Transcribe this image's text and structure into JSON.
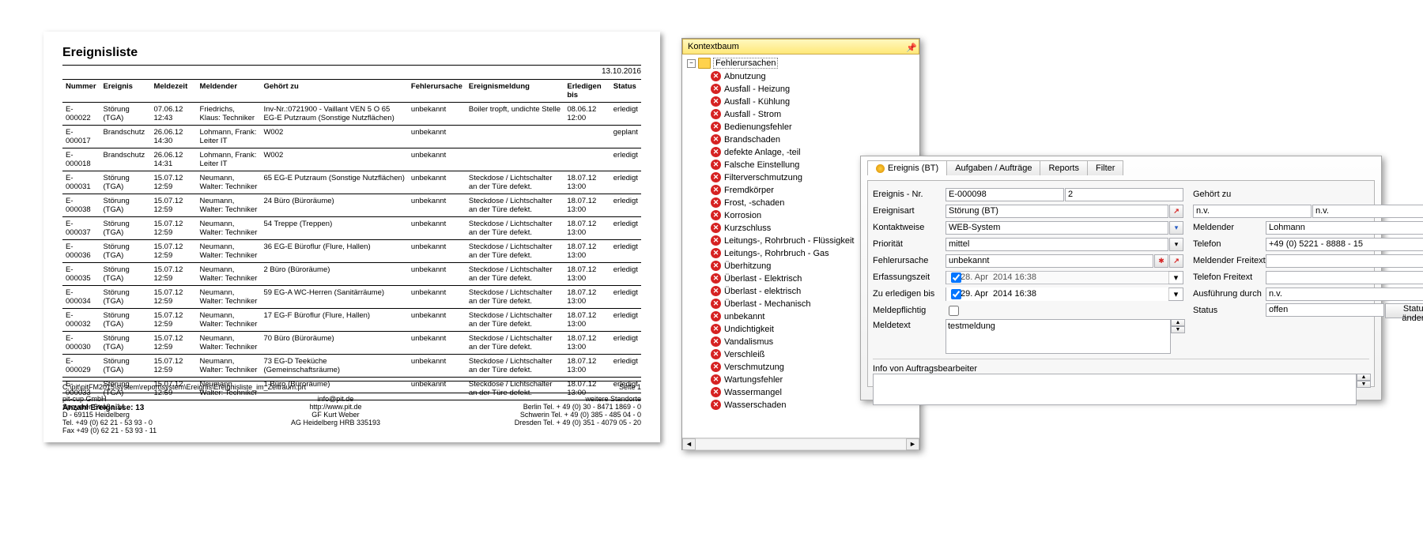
{
  "report": {
    "title": "Ereignisliste",
    "date": "13.10.2016",
    "cols": [
      "Nummer",
      "Ereignis",
      "Meldezeit",
      "Meldender",
      "Gehört zu",
      "Fehlerursache",
      "Ereignismeldung",
      "Erledigen bis",
      "Status"
    ],
    "rows": [
      [
        "E-000022",
        "Störung (TGA)",
        "07.06.12 12:43",
        "Friedrichs, Klaus: Techniker",
        "Inv-Nr.:0721900 - Vaillant VEN 5 O 65 EG-E Putzraum (Sonstige Nutzflächen)",
        "unbekannt",
        "Boiler tropft, undichte Stelle",
        "08.06.12 12:00",
        "erledigt"
      ],
      [
        "E-000017",
        "Brandschutz",
        "26.06.12 14:30",
        "Lohmann, Frank: Leiter IT",
        "W002",
        "unbekannt",
        "",
        "",
        "geplant"
      ],
      [
        "E-000018",
        "Brandschutz",
        "26.06.12 14:31",
        "Lohmann, Frank: Leiter IT",
        "W002",
        "unbekannt",
        "",
        "",
        "erledigt"
      ],
      [
        "E-000031",
        "Störung (TGA)",
        "15.07.12 12:59",
        "Neumann, Walter: Techniker",
        "65 EG-E Putzraum (Sonstige Nutzflächen)",
        "unbekannt",
        "Steckdose / Lichtschalter an der Türe defekt.",
        "18.07.12 13:00",
        "erledigt"
      ],
      [
        "E-000038",
        "Störung (TGA)",
        "15.07.12 12:59",
        "Neumann, Walter: Techniker",
        "24 Büro (Büroräume)",
        "unbekannt",
        "Steckdose / Lichtschalter an der Türe defekt.",
        "18.07.12 13:00",
        "erledigt"
      ],
      [
        "E-000037",
        "Störung (TGA)",
        "15.07.12 12:59",
        "Neumann, Walter: Techniker",
        "54 Treppe (Treppen)",
        "unbekannt",
        "Steckdose / Lichtschalter an der Türe defekt.",
        "18.07.12 13:00",
        "erledigt"
      ],
      [
        "E-000036",
        "Störung (TGA)",
        "15.07.12 12:59",
        "Neumann, Walter: Techniker",
        "36 EG-E Büroflur (Flure, Hallen)",
        "unbekannt",
        "Steckdose / Lichtschalter an der Türe defekt.",
        "18.07.12 13:00",
        "erledigt"
      ],
      [
        "E-000035",
        "Störung (TGA)",
        "15.07.12 12:59",
        "Neumann, Walter: Techniker",
        "2 Büro (Büroräume)",
        "unbekannt",
        "Steckdose / Lichtschalter an der Türe defekt.",
        "18.07.12 13:00",
        "erledigt"
      ],
      [
        "E-000034",
        "Störung (TGA)",
        "15.07.12 12:59",
        "Neumann, Walter: Techniker",
        "59 EG-A WC-Herren (Sanitärräume)",
        "unbekannt",
        "Steckdose / Lichtschalter an der Türe defekt.",
        "18.07.12 13:00",
        "erledigt"
      ],
      [
        "E-000032",
        "Störung (TGA)",
        "15.07.12 12:59",
        "Neumann, Walter: Techniker",
        "17 EG-F Büroflur (Flure, Hallen)",
        "unbekannt",
        "Steckdose / Lichtschalter an der Türe defekt.",
        "18.07.12 13:00",
        "erledigt"
      ],
      [
        "E-000030",
        "Störung (TGA)",
        "15.07.12 12:59",
        "Neumann, Walter: Techniker",
        "70 Büro (Büroräume)",
        "unbekannt",
        "Steckdose / Lichtschalter an der Türe defekt.",
        "18.07.12 13:00",
        "erledigt"
      ],
      [
        "E-000029",
        "Störung (TGA)",
        "15.07.12 12:59",
        "Neumann, Walter: Techniker",
        "73 EG-D Teeküche (Gemeinschaftsräume)",
        "unbekannt",
        "Steckdose / Lichtschalter an der Türe defekt.",
        "18.07.12 13:00",
        "erledigt"
      ],
      [
        "E-000033",
        "Störung (TGA)",
        "15.07.12 12:59",
        "Neumann, Walter: Techniker",
        "1 Büro (Büroräume)",
        "unbekannt",
        "Steckdose / Lichtschalter an der Türe defekt.",
        "18.07.12 13:00",
        "erledigt"
      ]
    ],
    "count": "Anzahl Ereignisse: 13",
    "path": "C:\\pit\\pitFM2015\\system\\report\\system\\Ereignis\\Ereignisliste_im_Zeitraum.prt",
    "page": "Seite 1",
    "footer": {
      "c1": [
        "pit-cup GmbH",
        "Speyerer Straße 14",
        "D - 69115 Heidelberg",
        "Tel. +49 (0) 62 21 - 53 93 - 0",
        "Fax +49 (0) 62 21 - 53 93 - 11"
      ],
      "c2": [
        "info@pit.de",
        "http://www.pit.de",
        "GF Kurt Weber",
        "AG Heidelberg HRB 335193"
      ],
      "c3": [
        "weitere Standorte",
        "Berlin Tel. + 49 (0) 30 - 8471 1869 - 0",
        "Schwerin Tel. + 49 (0) 385 - 485 04 - 0",
        "Dresden Tel. + 49 (0) 351 - 4079 05 - 20"
      ]
    }
  },
  "tree": {
    "title": "Kontextbaum",
    "root": "Fehlerursachen",
    "items": [
      "Abnutzung",
      "Ausfall - Heizung",
      "Ausfall - Kühlung",
      "Ausfall - Strom",
      "Bedienungsfehler",
      "Brandschaden",
      "defekte Anlage, -teil",
      "Falsche Einstellung",
      "Filterverschmutzung",
      "Fremdkörper",
      "Frost, -schaden",
      "Korrosion",
      "Kurzschluss",
      "Leitungs-, Rohrbruch - Flüssigkeit",
      "Leitungs-, Rohrbruch - Gas",
      "Überhitzung",
      "Überlast - Elektrisch",
      "Überlast - elektrisch",
      "Überlast - Mechanisch",
      "unbekannt",
      "Undichtigkeit",
      "Vandalismus",
      "Verschleiß",
      "Verschmutzung",
      "Wartungsfehler",
      "Wassermangel",
      "Wasserschaden"
    ]
  },
  "form": {
    "tabs": [
      "Ereignis (BT)",
      "Aufgaben / Aufträge",
      "Reports",
      "Filter"
    ],
    "labels": {
      "nr": "Ereignis - Nr.",
      "art": "Ereignisart",
      "kontakt": "Kontaktweise",
      "prio": "Priorität",
      "ursache": "Fehlerursache",
      "erfasst": "Erfassungszeit",
      "erledigen": "Zu erledigen bis",
      "meldepflicht": "Meldepflichtig",
      "meldetext": "Meldetext",
      "info": "Info von Auftragsbearbeiter",
      "gehoert": "Gehört zu",
      "meldender": "Meldender",
      "telefon": "Telefon",
      "meldfrei": "Meldender Freitext",
      "telfrei": "Telefon Freitext",
      "ausf": "Ausführung durch",
      "status": "Status",
      "statusbtn": "Status ändern"
    },
    "values": {
      "nr": "E-000098",
      "nr_seq": "2",
      "art": "Störung (BT)",
      "kontakt": "WEB-System",
      "prio": "mittel",
      "ursache": "unbekannt",
      "erfasst": "28. Apr  2014 16:38",
      "erledigen": "29. Apr  2014 16:38",
      "meldetext": "testmeldung",
      "gehoert": "n.v.",
      "gehoert2": "n.v.",
      "meldender": "Lohmann",
      "telefon": "+49 (0) 5221 - 8888 - 15",
      "ausf": "n.v.",
      "status": "offen"
    }
  }
}
